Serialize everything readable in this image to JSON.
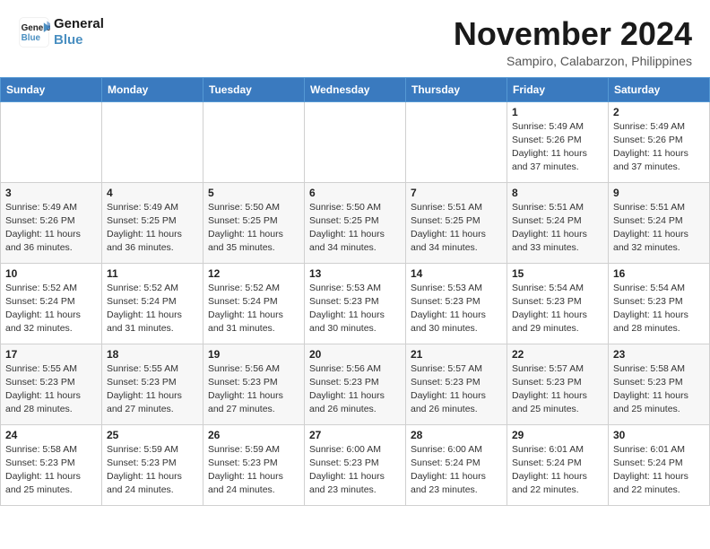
{
  "header": {
    "logo_line1": "General",
    "logo_line2": "Blue",
    "month_title": "November 2024",
    "location": "Sampiro, Calabarzon, Philippines"
  },
  "weekdays": [
    "Sunday",
    "Monday",
    "Tuesday",
    "Wednesday",
    "Thursday",
    "Friday",
    "Saturday"
  ],
  "weeks": [
    [
      {
        "day": "",
        "info": ""
      },
      {
        "day": "",
        "info": ""
      },
      {
        "day": "",
        "info": ""
      },
      {
        "day": "",
        "info": ""
      },
      {
        "day": "",
        "info": ""
      },
      {
        "day": "1",
        "info": "Sunrise: 5:49 AM\nSunset: 5:26 PM\nDaylight: 11 hours and 37 minutes."
      },
      {
        "day": "2",
        "info": "Sunrise: 5:49 AM\nSunset: 5:26 PM\nDaylight: 11 hours and 37 minutes."
      }
    ],
    [
      {
        "day": "3",
        "info": "Sunrise: 5:49 AM\nSunset: 5:26 PM\nDaylight: 11 hours and 36 minutes."
      },
      {
        "day": "4",
        "info": "Sunrise: 5:49 AM\nSunset: 5:25 PM\nDaylight: 11 hours and 36 minutes."
      },
      {
        "day": "5",
        "info": "Sunrise: 5:50 AM\nSunset: 5:25 PM\nDaylight: 11 hours and 35 minutes."
      },
      {
        "day": "6",
        "info": "Sunrise: 5:50 AM\nSunset: 5:25 PM\nDaylight: 11 hours and 34 minutes."
      },
      {
        "day": "7",
        "info": "Sunrise: 5:51 AM\nSunset: 5:25 PM\nDaylight: 11 hours and 34 minutes."
      },
      {
        "day": "8",
        "info": "Sunrise: 5:51 AM\nSunset: 5:24 PM\nDaylight: 11 hours and 33 minutes."
      },
      {
        "day": "9",
        "info": "Sunrise: 5:51 AM\nSunset: 5:24 PM\nDaylight: 11 hours and 32 minutes."
      }
    ],
    [
      {
        "day": "10",
        "info": "Sunrise: 5:52 AM\nSunset: 5:24 PM\nDaylight: 11 hours and 32 minutes."
      },
      {
        "day": "11",
        "info": "Sunrise: 5:52 AM\nSunset: 5:24 PM\nDaylight: 11 hours and 31 minutes."
      },
      {
        "day": "12",
        "info": "Sunrise: 5:52 AM\nSunset: 5:24 PM\nDaylight: 11 hours and 31 minutes."
      },
      {
        "day": "13",
        "info": "Sunrise: 5:53 AM\nSunset: 5:23 PM\nDaylight: 11 hours and 30 minutes."
      },
      {
        "day": "14",
        "info": "Sunrise: 5:53 AM\nSunset: 5:23 PM\nDaylight: 11 hours and 30 minutes."
      },
      {
        "day": "15",
        "info": "Sunrise: 5:54 AM\nSunset: 5:23 PM\nDaylight: 11 hours and 29 minutes."
      },
      {
        "day": "16",
        "info": "Sunrise: 5:54 AM\nSunset: 5:23 PM\nDaylight: 11 hours and 28 minutes."
      }
    ],
    [
      {
        "day": "17",
        "info": "Sunrise: 5:55 AM\nSunset: 5:23 PM\nDaylight: 11 hours and 28 minutes."
      },
      {
        "day": "18",
        "info": "Sunrise: 5:55 AM\nSunset: 5:23 PM\nDaylight: 11 hours and 27 minutes."
      },
      {
        "day": "19",
        "info": "Sunrise: 5:56 AM\nSunset: 5:23 PM\nDaylight: 11 hours and 27 minutes."
      },
      {
        "day": "20",
        "info": "Sunrise: 5:56 AM\nSunset: 5:23 PM\nDaylight: 11 hours and 26 minutes."
      },
      {
        "day": "21",
        "info": "Sunrise: 5:57 AM\nSunset: 5:23 PM\nDaylight: 11 hours and 26 minutes."
      },
      {
        "day": "22",
        "info": "Sunrise: 5:57 AM\nSunset: 5:23 PM\nDaylight: 11 hours and 25 minutes."
      },
      {
        "day": "23",
        "info": "Sunrise: 5:58 AM\nSunset: 5:23 PM\nDaylight: 11 hours and 25 minutes."
      }
    ],
    [
      {
        "day": "24",
        "info": "Sunrise: 5:58 AM\nSunset: 5:23 PM\nDaylight: 11 hours and 25 minutes."
      },
      {
        "day": "25",
        "info": "Sunrise: 5:59 AM\nSunset: 5:23 PM\nDaylight: 11 hours and 24 minutes."
      },
      {
        "day": "26",
        "info": "Sunrise: 5:59 AM\nSunset: 5:23 PM\nDaylight: 11 hours and 24 minutes."
      },
      {
        "day": "27",
        "info": "Sunrise: 6:00 AM\nSunset: 5:23 PM\nDaylight: 11 hours and 23 minutes."
      },
      {
        "day": "28",
        "info": "Sunrise: 6:00 AM\nSunset: 5:24 PM\nDaylight: 11 hours and 23 minutes."
      },
      {
        "day": "29",
        "info": "Sunrise: 6:01 AM\nSunset: 5:24 PM\nDaylight: 11 hours and 22 minutes."
      },
      {
        "day": "30",
        "info": "Sunrise: 6:01 AM\nSunset: 5:24 PM\nDaylight: 11 hours and 22 minutes."
      }
    ]
  ]
}
